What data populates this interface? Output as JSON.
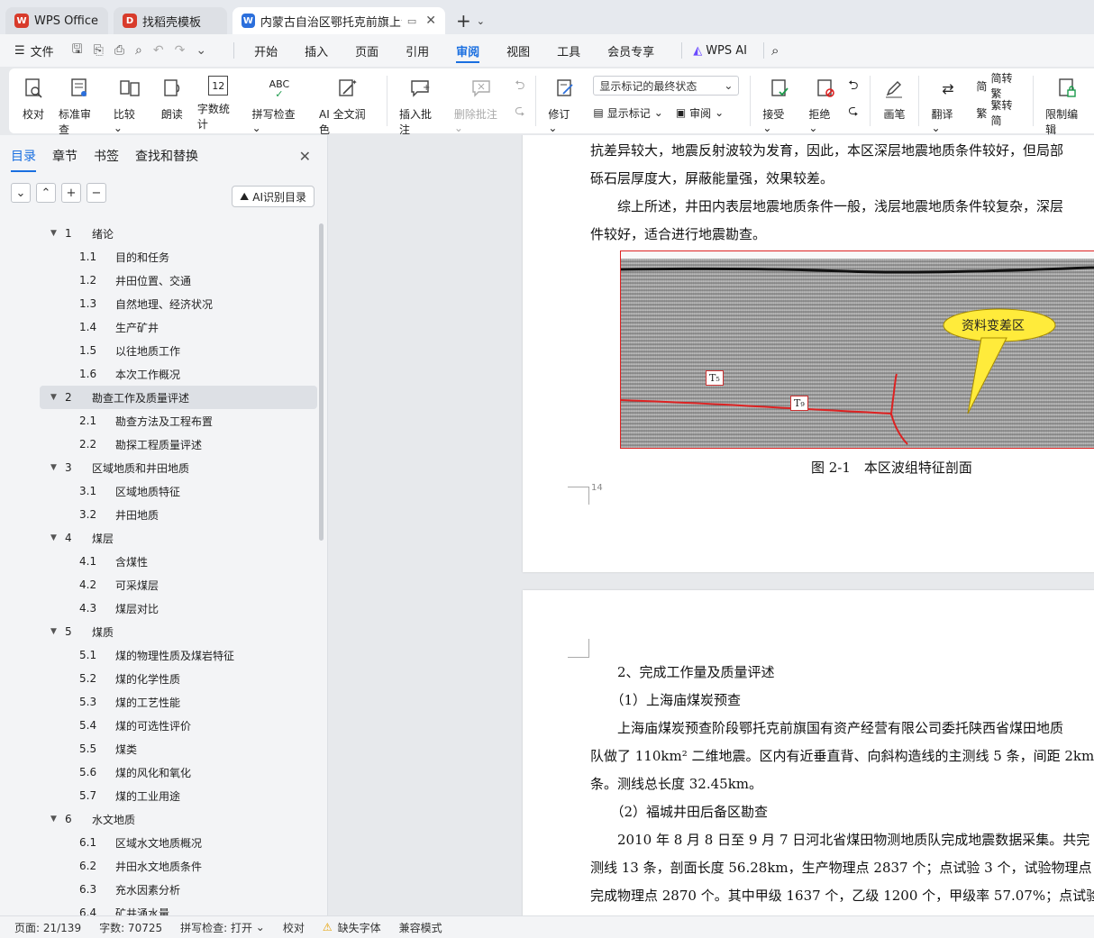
{
  "tabs": [
    {
      "label": "WPS Office",
      "logo": "W",
      "color": "#d83b2b"
    },
    {
      "label": "找稻壳模板",
      "logo": "D",
      "color": "#d83b2b"
    },
    {
      "label": "内蒙古自治区鄂托克前旗上海",
      "logo": "W",
      "color": "#2b6fdc"
    }
  ],
  "menu": {
    "file": "文件",
    "items": [
      "开始",
      "插入",
      "页面",
      "引用",
      "审阅",
      "视图",
      "工具",
      "会员专享"
    ],
    "active": "审阅",
    "wps_ai": "WPS AI"
  },
  "ribbon": {
    "proofread": "校对",
    "standard_review": "标准审查",
    "compare": "比较",
    "read_aloud": "朗读",
    "word_count": "字数统计",
    "spell_check": "拼写检查",
    "ai_polish": "AI 全文润色",
    "insert_comment": "插入批注",
    "delete_comment": "删除批注",
    "revise": "修订",
    "markup_mode": "显示标记的最终状态",
    "show_markup": "显示标记",
    "review": "审阅",
    "accept": "接受",
    "reject": "拒绝",
    "pen": "画笔",
    "translate": "翻译",
    "to_traditional": "简转繁",
    "to_simplified": "繁转简",
    "restrict_edit": "限制编辑",
    "word_count_icon_text": "12",
    "spell_icon_text": "ABC",
    "trad_glyph": "简",
    "simp_glyph": "繁"
  },
  "panel": {
    "tabs": [
      "目录",
      "章节",
      "书签",
      "查找和替换"
    ],
    "active_tab": "目录",
    "ai_toc": "AI识别目录"
  },
  "toc": [
    {
      "level": 1,
      "num": "1",
      "title": "绪论"
    },
    {
      "level": 2,
      "num": "1.1",
      "title": "目的和任务"
    },
    {
      "level": 2,
      "num": "1.2",
      "title": "井田位置、交通"
    },
    {
      "level": 2,
      "num": "1.3",
      "title": "自然地理、经济状况"
    },
    {
      "level": 2,
      "num": "1.4",
      "title": "生产矿井"
    },
    {
      "level": 2,
      "num": "1.5",
      "title": "以往地质工作"
    },
    {
      "level": 2,
      "num": "1.6",
      "title": "本次工作概况"
    },
    {
      "level": 1,
      "num": "2",
      "title": "勘查工作及质量评述",
      "selected": true
    },
    {
      "level": 2,
      "num": "2.1",
      "title": "勘查方法及工程布置"
    },
    {
      "level": 2,
      "num": "2.2",
      "title": "勘探工程质量评述"
    },
    {
      "level": 1,
      "num": "3",
      "title": "区域地质和井田地质"
    },
    {
      "level": 2,
      "num": "3.1",
      "title": "区域地质特征"
    },
    {
      "level": 2,
      "num": "3.2",
      "title": "井田地质"
    },
    {
      "level": 1,
      "num": "4",
      "title": "煤层"
    },
    {
      "level": 2,
      "num": "4.1",
      "title": "含煤性"
    },
    {
      "level": 2,
      "num": "4.2",
      "title": "可采煤层"
    },
    {
      "level": 2,
      "num": "4.3",
      "title": "煤层对比"
    },
    {
      "level": 1,
      "num": "5",
      "title": "煤质"
    },
    {
      "level": 2,
      "num": "5.1",
      "title": "煤的物理性质及煤岩特征"
    },
    {
      "level": 2,
      "num": "5.2",
      "title": "煤的化学性质"
    },
    {
      "level": 2,
      "num": "5.3",
      "title": "煤的工艺性能"
    },
    {
      "level": 2,
      "num": "5.4",
      "title": "煤的可选性评价"
    },
    {
      "level": 2,
      "num": "5.5",
      "title": "煤类"
    },
    {
      "level": 2,
      "num": "5.6",
      "title": "煤的风化和氧化"
    },
    {
      "level": 2,
      "num": "5.7",
      "title": "煤的工业用途"
    },
    {
      "level": 1,
      "num": "6",
      "title": "水文地质"
    },
    {
      "level": 2,
      "num": "6.1",
      "title": "区域水文地质概况"
    },
    {
      "level": 2,
      "num": "6.2",
      "title": "井田水文地质条件"
    },
    {
      "level": 2,
      "num": "6.3",
      "title": "充水因素分析"
    },
    {
      "level": 2,
      "num": "6.4",
      "title": "矿井涌水量"
    }
  ],
  "page1": {
    "lines": [
      "抗差异较大，地震反射波较为发育，因此，本区深层地震地质条件较好，但局部",
      "砾石层厚度大，屏蔽能量强，效果较差。",
      "　　综上所述，井田内表层地震地质条件一般，浅层地震地质条件较复杂，深层",
      "件较好，适合进行地震勘查。"
    ],
    "figure_bubble": "资料变差区",
    "label_t5": "T₅",
    "label_t9": "T₉",
    "caption": "图 2-1　本区波组特征剖面",
    "page_number": "14"
  },
  "page2": {
    "lines": [
      "　　2、完成工作量及质量评述",
      "　　（1）上海庙煤炭预查",
      "　　上海庙煤炭预查阶段鄂托克前旗国有资产经营有限公司委托陕西省煤田地质",
      "队做了 110km² 二维地震。区内有近垂直背、向斜构造线的主测线 5 条，间距 2km",
      "条。测线总长度 32.45km。",
      "　　（2）福城井田后备区勘查",
      "　　2010 年 8 月 8 日至 9 月 7 日河北省煤田物测地质队完成地震数据采集。共完",
      "测线 13 条，剖面长度 56.28km，生产物理点 2837 个；点试验 3 个，试验物理点",
      "完成物理点 2870 个。其中甲级 1637 个，乙级 1200 个，甲级率 57.07%；点试验"
    ]
  },
  "status": {
    "page": "页面: 21/139",
    "words": "字数: 70725",
    "spell": "拼写检查: 打开",
    "proof": "校对",
    "missing_font": "缺失字体",
    "compat": "兼容模式"
  }
}
